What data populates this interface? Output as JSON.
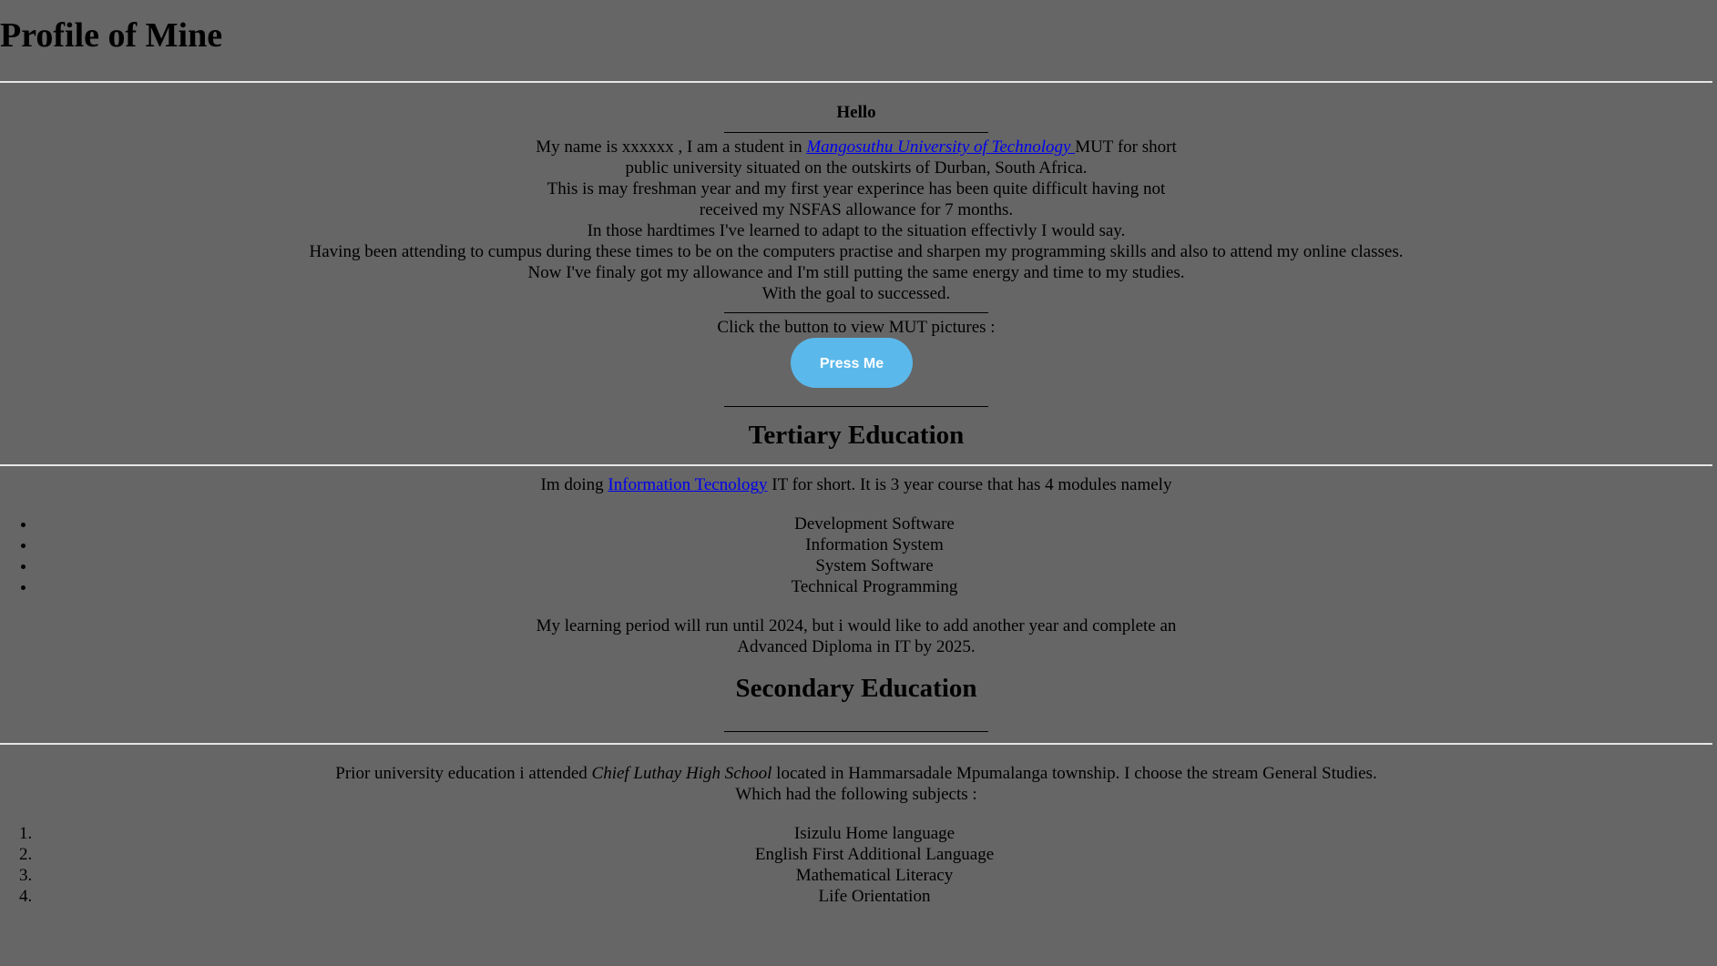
{
  "page_title": "Profile of Mine",
  "intro": {
    "greeting": "Hello",
    "line1_before": "My name is xxxxxx , I am a student in ",
    "university_link": "Mangosuthu University of Technology ",
    "line1_after": "MUT for short",
    "line2": "public university situated on the outskirts of Durban, South Africa.",
    "line3": "This is may freshman year and my first year experince has been quite difficult having not",
    "line4": "received my NSFAS allowance for 7 months.",
    "line5": "In those hardtimes I've learned to adapt to the situation effectivly I would say.",
    "line6": "Having been attending to cumpus during these times to be on the computers practise and sharpen my programming skills and also to attend my online classes.",
    "line7": "Now I've finaly got my allowance and I'm still putting the same energy and time to my studies.",
    "line8": "With the goal to successed."
  },
  "pictures": {
    "prompt": "Click the button to view MUT pictures :",
    "button_label": "Press Me"
  },
  "tertiary": {
    "heading": "Tertiary Education",
    "intro_before": "Im doing ",
    "course_link": "Information Tecnology",
    "intro_after": " IT for short. It is 3 year course that has 4 modules namely",
    "modules": [
      "Development Software",
      "Information System",
      "System Software",
      "Technical Programming"
    ],
    "plan_line1": "My learning period will run until 2024, but i would like to add another year and complete an",
    "plan_line2": "Advanced Diploma in IT by 2025."
  },
  "secondary": {
    "heading": "Secondary Education",
    "intro_before": "Prior university education i attended ",
    "school_name": "Chief Luthay High School",
    "intro_after": " located in Hammarsadale Mpumalanga township. I choose the stream General Studies.",
    "intro_line2": "Which had the following subjects :",
    "subjects": [
      "Isizulu Home language",
      "English First Additional Language",
      "Mathematical Literacy",
      "Life Orientation"
    ]
  },
  "colors": {
    "background": "#666666",
    "button": "#5bb8ea",
    "link": "#0000ee"
  }
}
